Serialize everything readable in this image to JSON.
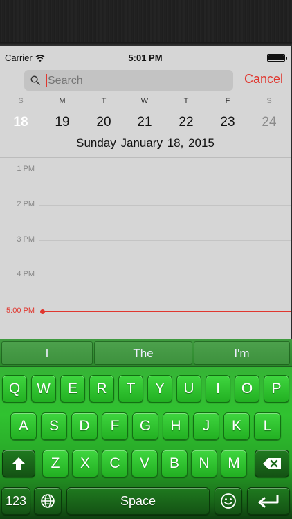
{
  "status_bar": {
    "carrier": "Carrier",
    "time": "5:01 PM"
  },
  "search": {
    "placeholder": "Search",
    "cancel_label": "Cancel"
  },
  "week": {
    "weekdays": [
      "S",
      "M",
      "T",
      "W",
      "T",
      "F",
      "S"
    ],
    "days": [
      "18",
      "19",
      "20",
      "21",
      "22",
      "23",
      "24"
    ],
    "selected_day": "18",
    "selected_date": "Sunday  January 18, 2015"
  },
  "timeline": {
    "hours": [
      "1 PM",
      "2 PM",
      "3 PM",
      "4 PM"
    ],
    "now_label": "5:00 PM"
  },
  "keyboard": {
    "suggestions": [
      "I",
      "The",
      "I'm"
    ],
    "row1": [
      "Q",
      "W",
      "E",
      "R",
      "T",
      "Y",
      "U",
      "I",
      "O",
      "P"
    ],
    "row2": [
      "A",
      "S",
      "D",
      "F",
      "G",
      "H",
      "J",
      "K",
      "L"
    ],
    "row3": [
      "Z",
      "X",
      "C",
      "V",
      "B",
      "N",
      "M"
    ],
    "numbers_label": "123",
    "space_label": "Space",
    "icons": {
      "shift": "shift-arrow-icon",
      "delete": "backspace-icon",
      "globe": "globe-icon",
      "emoji": "emoji-icon",
      "return": "return-arrow-icon"
    }
  },
  "colors": {
    "accent_red": "#e0372f",
    "keyboard_green": "#36b336"
  }
}
